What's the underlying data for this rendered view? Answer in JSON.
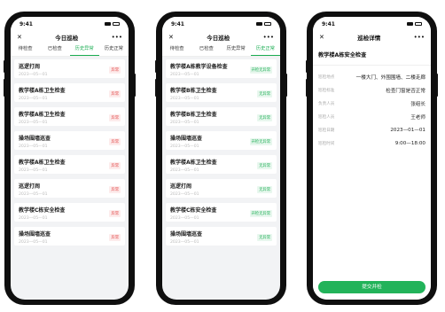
{
  "status_time": "9:41",
  "phone1": {
    "title": "今日巡检",
    "tabs": [
      "待检查",
      "已检查",
      "历史异常",
      "历史正常"
    ],
    "active_tab": 2,
    "items": [
      {
        "title": "巡逻打闹",
        "date": "2023—05—01",
        "badge": "异常",
        "tone": "red"
      },
      {
        "title": "教学楼A栋卫生检查",
        "date": "2023—05—01",
        "badge": "异常",
        "tone": "red"
      },
      {
        "title": "教学楼A栋卫生检查",
        "date": "2023—05—01",
        "badge": "异常",
        "tone": "red"
      },
      {
        "title": "操场围墙巡查",
        "date": "2023—05—01",
        "badge": "异常",
        "tone": "red"
      },
      {
        "title": "教学楼A栋卫生检查",
        "date": "2023—05—01",
        "badge": "异常",
        "tone": "red"
      },
      {
        "title": "巡逻打闹",
        "date": "2023—05—01",
        "badge": "异常",
        "tone": "red"
      },
      {
        "title": "教学楼C栋安全检查",
        "date": "2023—05—01",
        "badge": "异常",
        "tone": "red"
      },
      {
        "title": "操场围墙巡查",
        "date": "2023—05—01",
        "badge": "异常",
        "tone": "red"
      }
    ]
  },
  "phone2": {
    "title": "今日巡检",
    "tabs": [
      "待检查",
      "已检查",
      "历史异常",
      "历史正常"
    ],
    "active_tab": 3,
    "items": [
      {
        "title": "教学楼A栋教学设备检查",
        "date": "2023—05—01",
        "badge": "开检无异常",
        "tone": "green"
      },
      {
        "title": "教学楼B栋卫生检查",
        "date": "2023—05—01",
        "badge": "无异常",
        "tone": "green"
      },
      {
        "title": "教学楼B栋卫生检查",
        "date": "2023—05—01",
        "badge": "无异常",
        "tone": "green"
      },
      {
        "title": "操场围墙巡查",
        "date": "2023—05—01",
        "badge": "开检无异常",
        "tone": "green"
      },
      {
        "title": "教学楼A栋卫生检查",
        "date": "2023—05—01",
        "badge": "无异常",
        "tone": "green"
      },
      {
        "title": "巡逻打闹",
        "date": "2023—05—01",
        "badge": "无异常",
        "tone": "green"
      },
      {
        "title": "教学楼C栋安全检查",
        "date": "2023—05—01",
        "badge": "开检无异常",
        "tone": "green"
      },
      {
        "title": "操场围墙巡查",
        "date": "2023—05—01",
        "badge": "无异常",
        "tone": "green"
      }
    ]
  },
  "phone3": {
    "title": "巡检详情",
    "heading": "教学楼A栋安全检查",
    "rows": [
      {
        "label": "巡检地点",
        "value": "一楼大门、外围围墙、二楼走廊"
      },
      {
        "label": "巡检标准",
        "value": "检查门窗是否正常"
      },
      {
        "label": "负责人员",
        "value": "张组长"
      },
      {
        "label": "巡检人员",
        "value": "王老师"
      },
      {
        "label": "巡检日期",
        "value": "2023—01—01"
      },
      {
        "label": "巡检时间",
        "value": "9:00—18:00"
      }
    ],
    "submit_label": "提交并检"
  },
  "icons": {
    "close": "close-icon",
    "more": "more-icon"
  }
}
